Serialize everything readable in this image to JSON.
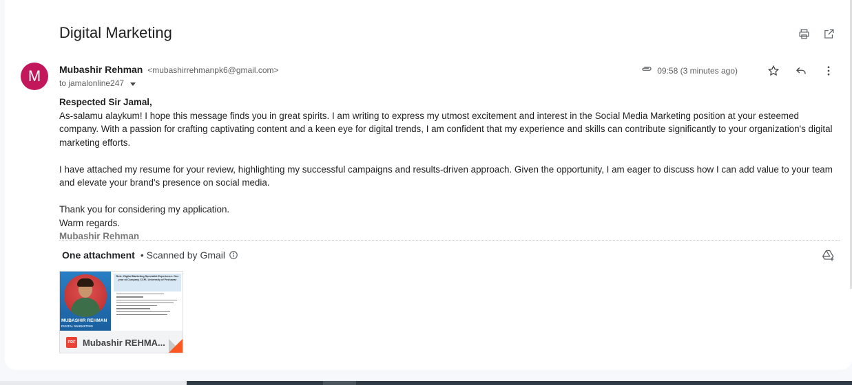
{
  "email": {
    "subject": "Digital Marketing",
    "sender_initial": "M",
    "sender_name": "Mubashir Rehman",
    "sender_email": "<mubashirrehmanpk6@gmail.com>",
    "to_line": "to jamalonline247",
    "time": "09:58 (3 minutes ago)",
    "body": {
      "greeting": "Respected Sir Jamal,",
      "p1": "As-salamu alaykum! I hope this message finds you in great spirits. I am writing to express my utmost excitement and interest in the Social Media Marketing position at your esteemed company. With a passion for crafting captivating content and a keen eye for digital trends, I am confident that my experience and skills can contribute significantly to your organization's digital marketing efforts.",
      "p2": "I have attached my resume for your review, highlighting my successful campaigns and results-driven approach. Given the opportunity, I am eager to discuss how I can add value to your team and elevate your brand's presence on social media.",
      "p3": "Thank you for considering my application.",
      "p4": "Warm regards.",
      "signature": "Mubashir Rehman"
    }
  },
  "attachments": {
    "title": "One attachment",
    "scanned": "• Scanned by Gmail",
    "items": [
      {
        "name": "Mubashir REHMA...",
        "type_badge": "PDF",
        "thumb_name": "MUBASHIR REHMAN",
        "thumb_role": "DIGITAL MARKETING",
        "thumb_heading": "Role: Digital Marketing Specialist Experience: One year at Company CCPL University of Peshawar"
      }
    ]
  },
  "icons": {
    "print": "print-icon",
    "open_new": "open-in-new-icon",
    "attachment": "paperclip-icon",
    "star": "star-icon",
    "reply": "reply-icon",
    "more": "more-vert-icon",
    "info": "info-icon",
    "drive": "add-to-drive-icon"
  },
  "colors": {
    "avatar": "#c2185b",
    "pdf": "#ea4335"
  }
}
